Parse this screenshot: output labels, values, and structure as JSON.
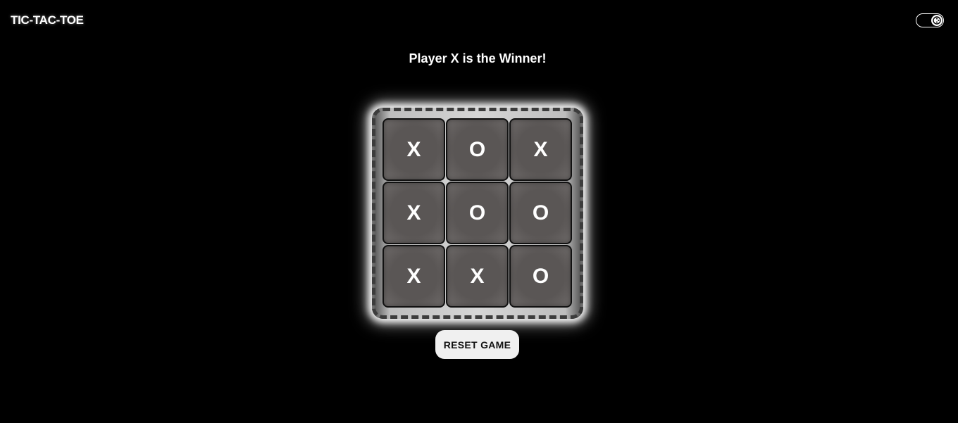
{
  "header": {
    "title": "TIC-TAC-TOE",
    "theme_toggle_icon": "palette-icon"
  },
  "status": {
    "message": "Player X is the Winner!"
  },
  "board": {
    "cells": [
      "X",
      "O",
      "X",
      "X",
      "O",
      "O",
      "X",
      "X",
      "O"
    ]
  },
  "controls": {
    "reset_label": "RESET GAME"
  },
  "colors": {
    "background": "#000000",
    "cell": "#5a5655",
    "text": "#ffffff",
    "button": "#f0f0f0"
  }
}
